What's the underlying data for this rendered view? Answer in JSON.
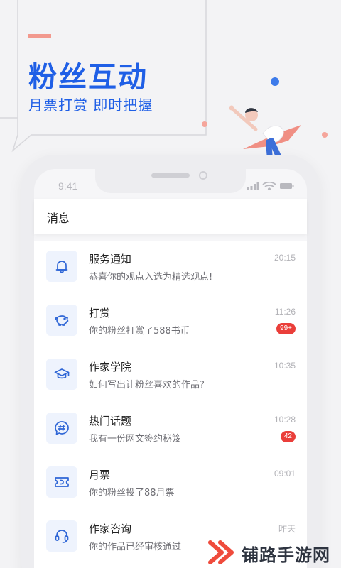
{
  "promo": {
    "title": "粉丝互动",
    "subtitle": "月票打赏 即时把握",
    "colors": {
      "brand": "#1f5fe6",
      "accent": "#f2998e"
    }
  },
  "status_bar": {
    "time": "9:41"
  },
  "page": {
    "title": "消息"
  },
  "messages": [
    {
      "title": "服务通知",
      "preview": "恭喜你的观点入选为精选观点!",
      "time": "20:15",
      "badge": "",
      "icon": "bell-icon"
    },
    {
      "title": "打赏",
      "preview": "你的粉丝打赏了588书币",
      "time": "11:26",
      "badge": "99+",
      "icon": "piggy-bank-icon"
    },
    {
      "title": "作家学院",
      "preview": "如何写出让粉丝喜欢的作品?",
      "time": "10:35",
      "badge": "",
      "icon": "graduation-cap-icon"
    },
    {
      "title": "热门话题",
      "preview": "我有一份网文签约秘笈",
      "time": "10:28",
      "badge": "42",
      "icon": "hashtag-icon"
    },
    {
      "title": "月票",
      "preview": "你的粉丝投了88月票",
      "time": "09:01",
      "badge": "",
      "icon": "ticket-icon"
    },
    {
      "title": "作家咨询",
      "preview": "你的作品已经审核通过",
      "time": "昨天",
      "badge": "",
      "icon": "headset-icon"
    }
  ],
  "watermark": {
    "text": "铺路手游网"
  }
}
